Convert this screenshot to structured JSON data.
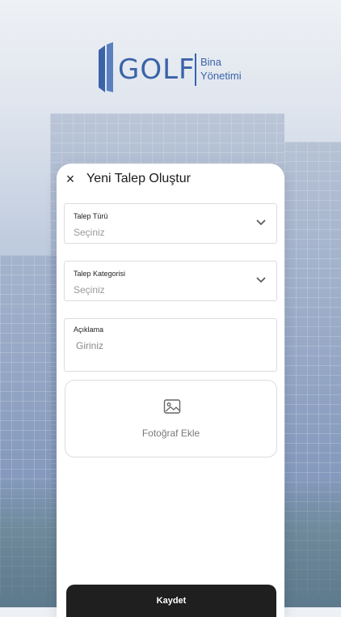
{
  "brand": {
    "name": "GOLF",
    "subtitle_line1": "Bina",
    "subtitle_line2": "Yönetimi",
    "color": "#3a63a8"
  },
  "form": {
    "title": "Yeni Talep Oluştur",
    "close_icon": "close-icon",
    "fields": [
      {
        "label": "Talep Türü",
        "placeholder": "Seçiniz",
        "type": "select"
      },
      {
        "label": "Talep Kategorisi",
        "placeholder": "Seçiniz",
        "type": "select"
      },
      {
        "label": "Açıklama",
        "placeholder": "Giriniz",
        "type": "textarea"
      }
    ],
    "photo": {
      "label": "Fotoğraf Ekle",
      "icon": "image-icon"
    },
    "save_label": "Kaydet"
  }
}
